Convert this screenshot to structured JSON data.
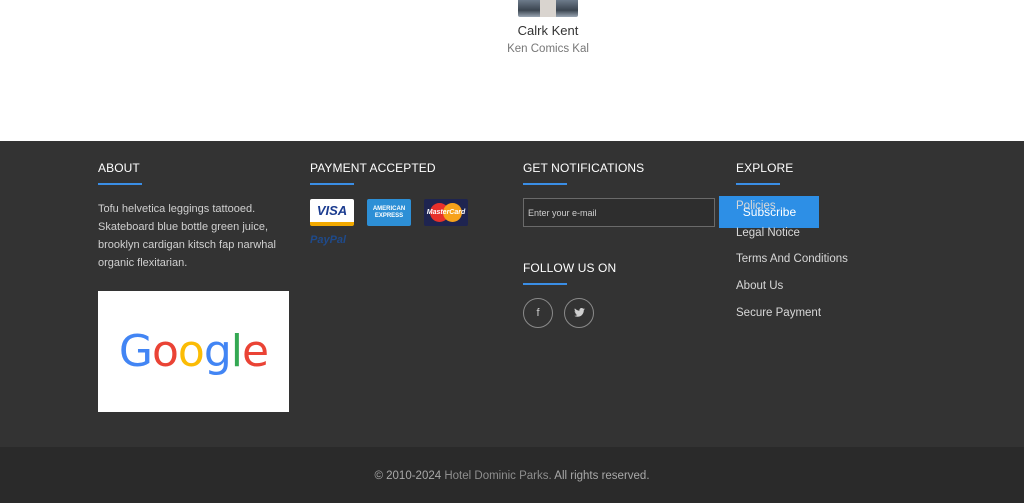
{
  "team_member": {
    "name": "Calrk Kent",
    "role": "Ken Comics Kal"
  },
  "footer": {
    "about": {
      "title": "ABOUT",
      "text": "Tofu helvetica leggings tattooed. Skateboard blue bottle green juice, brooklyn cardigan kitsch fap narwhal organic flexitarian.",
      "logo_text": "Google"
    },
    "payment": {
      "title": "PAYMENT ACCEPTED",
      "cards": [
        "VISA",
        "AMERICAN EXPRESS",
        "MasterCard"
      ],
      "paypal": "PayPal"
    },
    "notifications": {
      "title": "GET NOTIFICATIONS",
      "email_placeholder": "Enter your e-mail",
      "email_value": "",
      "subscribe_label": "Subscribe",
      "follow_title": "FOLLOW US ON",
      "socials": [
        {
          "icon": "facebook-icon",
          "glyph": "f"
        },
        {
          "icon": "twitter-icon",
          "glyph": "t"
        }
      ]
    },
    "explore": {
      "title": "EXPLORE",
      "links": [
        "Policies",
        "Legal Notice",
        "Terms And Conditions",
        "About Us",
        "Secure Payment"
      ]
    },
    "accent_color": "#3a8ee6"
  },
  "copyright": {
    "prefix": "© 2010-2024",
    "brand": "Hotel Dominic Parks.",
    "suffix": "All rights reserved."
  }
}
